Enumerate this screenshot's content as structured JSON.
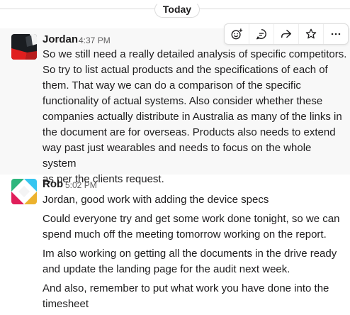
{
  "divider": {
    "label": "Today"
  },
  "toolbar": {
    "actions": [
      {
        "icon": "add-reaction-icon"
      },
      {
        "icon": "reply-in-thread-icon"
      },
      {
        "icon": "share-message-icon"
      },
      {
        "icon": "save-star-icon"
      },
      {
        "icon": "more-actions-icon"
      }
    ]
  },
  "messages": [
    {
      "author": "Jordan",
      "time": "4:37 PM",
      "avatar_colors": [
        "#1a1d21",
        "#e01e1e",
        "#ffffff"
      ],
      "lines": [
        "So we still need a really detailed analysis of specific competitors.",
        "So try to list actual products and the specifications of each of",
        "them. That way we can do a comparison of the specific",
        "functionality of actual systems. Also consider whether these",
        "companies actually distribute in Australia as many of the links in",
        "the document are for overseas. Products also needs to extend",
        "way past just wearables and needs to focus on the whole system",
        "as per the clients request."
      ]
    },
    {
      "author": "Rob",
      "time": "5:02 PM",
      "avatar_colors": [
        "#2eb67d",
        "#e01e5a",
        "#ecb22e",
        "#36c5f0"
      ],
      "paragraphs": [
        "Jordan, good work with adding the device specs",
        "Could everyone try and get some work done tonight, so we can spend much off the meeting tomorrow working on the report.",
        "Im also working on getting all the documents in the drive ready and update the landing page for the audit next week.",
        "And also, remember to put what work you have done into the timesheet"
      ]
    }
  ]
}
